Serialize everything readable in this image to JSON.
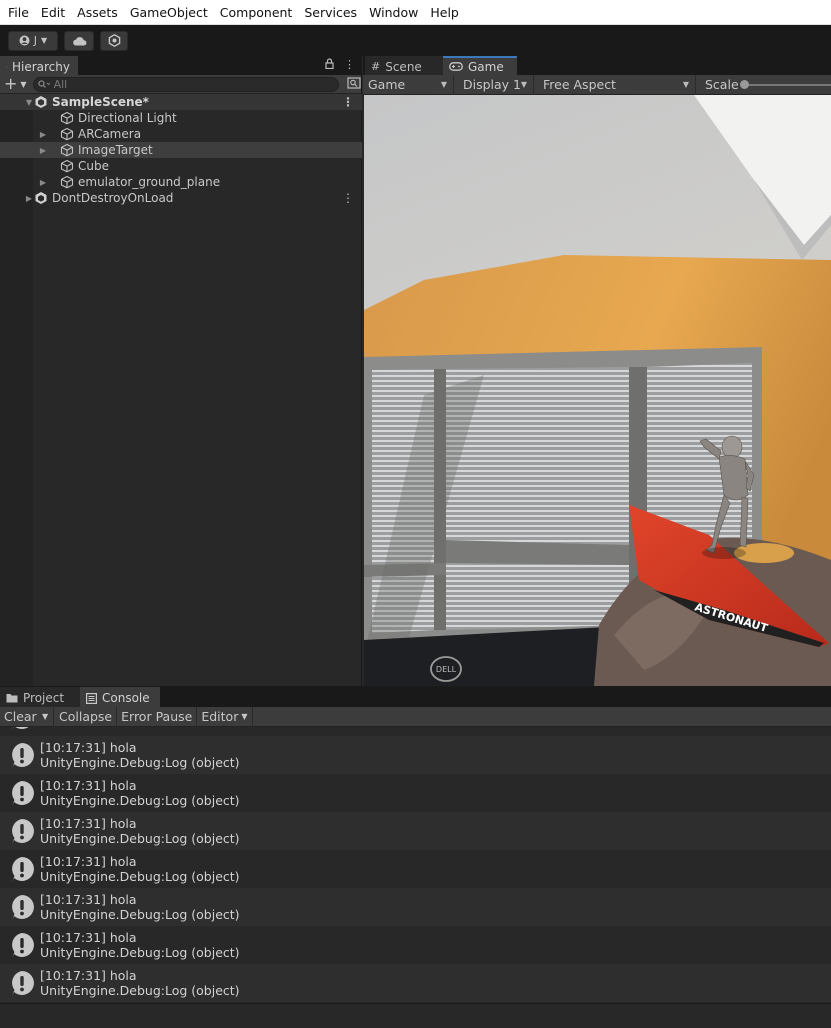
{
  "menu": [
    "File",
    "Edit",
    "Assets",
    "GameObject",
    "Component",
    "Services",
    "Window",
    "Help"
  ],
  "toolbar": {
    "account_label": "J",
    "cloud_icon": "cloud-icon",
    "collab_icon": "collab-icon"
  },
  "hierarchy": {
    "tab_label": "Hierarchy",
    "search_placeholder": "All",
    "items": [
      {
        "label": "SampleScene*",
        "kind": "scene"
      },
      {
        "label": "Directional Light",
        "kind": "object"
      },
      {
        "label": "ARCamera",
        "kind": "object"
      },
      {
        "label": "ImageTarget",
        "kind": "object",
        "selected": true
      },
      {
        "label": "Cube",
        "kind": "object"
      },
      {
        "label": "emulator_ground_plane",
        "kind": "object"
      },
      {
        "label": "DontDestroyOnLoad",
        "kind": "scene"
      }
    ]
  },
  "game": {
    "tabs": [
      "Scene",
      "Game"
    ],
    "active_tab": "Game",
    "view_mode": "Game",
    "display": "Display 1",
    "aspect": "Free Aspect",
    "scale_label": "Scale",
    "card_text": "ASTRONAUT",
    "monitor_brand": "DELL"
  },
  "bottom": {
    "tabs": [
      "Project",
      "Console"
    ],
    "active_tab": "Console",
    "toolbar": {
      "clear": "Clear",
      "collapse": "Collapse",
      "error_pause": "Error Pause",
      "editor": "Editor"
    },
    "logs": [
      {
        "line1": "[10:17:31] hola",
        "line2": "UnityEngine.Debug:Log (object)"
      },
      {
        "line1": "[10:17:31] hola",
        "line2": "UnityEngine.Debug:Log (object)"
      },
      {
        "line1": "[10:17:31] hola",
        "line2": "UnityEngine.Debug:Log (object)"
      },
      {
        "line1": "[10:17:31] hola",
        "line2": "UnityEngine.Debug:Log (object)"
      },
      {
        "line1": "[10:17:31] hola",
        "line2": "UnityEngine.Debug:Log (object)"
      },
      {
        "line1": "[10:17:31] hola",
        "line2": "UnityEngine.Debug:Log (object)"
      },
      {
        "line1": "[10:17:31] hola",
        "line2": "UnityEngine.Debug:Log (object)"
      }
    ]
  }
}
